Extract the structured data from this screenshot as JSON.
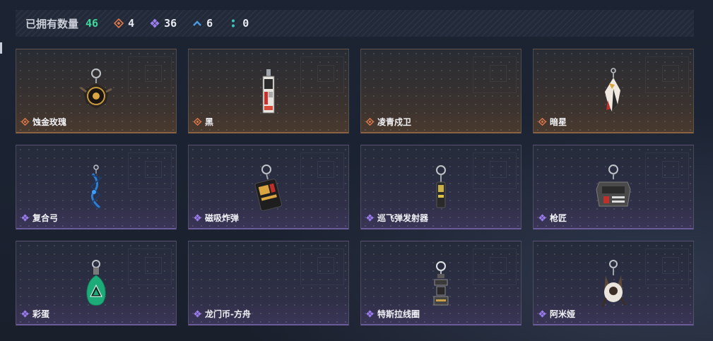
{
  "header": {
    "title": "已拥有数量",
    "total": "46",
    "stats": [
      {
        "icon": "orange-diamond-icon",
        "color": "#e0784a",
        "value": "4"
      },
      {
        "icon": "purple-diamond-icon",
        "color": "#9b7df0",
        "value": "36"
      },
      {
        "icon": "blue-chevron-icon",
        "color": "#4a9be0",
        "value": "6"
      },
      {
        "icon": "teal-dots-icon",
        "color": "#3cc6b7",
        "value": "0"
      }
    ]
  },
  "cards": [
    {
      "name": "蚀金玫瑰",
      "rarity": "orange",
      "icon": "rose-keychain-icon"
    },
    {
      "name": "黑",
      "rarity": "orange",
      "icon": "black-tag-keychain-icon"
    },
    {
      "name": "凌青戍卫",
      "rarity": "orange",
      "icon": ""
    },
    {
      "name": "暗星",
      "rarity": "orange",
      "icon": "dark-star-keychain-icon"
    },
    {
      "name": "复合弓",
      "rarity": "purple",
      "icon": "compound-bow-keychain-icon"
    },
    {
      "name": "磁吸炸弹",
      "rarity": "purple",
      "icon": "magnetic-bomb-keychain-icon"
    },
    {
      "name": "巡飞弹发射器",
      "rarity": "purple",
      "icon": "missile-launcher-keychain-icon"
    },
    {
      "name": "枪匠",
      "rarity": "purple",
      "icon": "gunsmith-keychain-icon"
    },
    {
      "name": "彩蛋",
      "rarity": "purple",
      "icon": "easter-egg-keychain-icon"
    },
    {
      "name": "龙门币-方舟",
      "rarity": "purple",
      "icon": ""
    },
    {
      "name": "特斯拉线圈",
      "rarity": "purple",
      "icon": "tesla-coil-keychain-icon"
    },
    {
      "name": "阿米娅",
      "rarity": "purple",
      "icon": "amiya-keychain-icon"
    }
  ],
  "colors": {
    "orange": "#e0784a",
    "purple": "#9b7df0",
    "accent_green": "#3ed79a"
  }
}
